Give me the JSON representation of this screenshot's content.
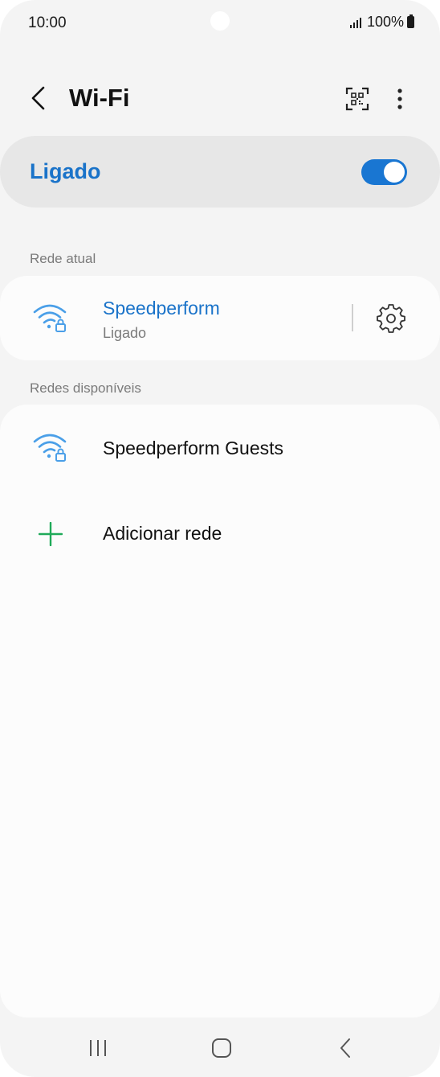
{
  "status_bar": {
    "time": "10:00",
    "battery_text": "100%",
    "signal_icon": "signal-bars-icon",
    "battery_icon": "battery-icon"
  },
  "app_bar": {
    "title": "Wi-Fi",
    "back_icon": "back-chevron-icon",
    "qr_icon": "qr-code-scanner-icon",
    "more_icon": "more-vertical-icon"
  },
  "master_switch": {
    "label": "Ligado",
    "on": true
  },
  "current_section": {
    "label": "Rede atual",
    "network": {
      "name": "Speedperform",
      "status": "Ligado",
      "icon": "wifi-secured-icon",
      "settings_icon": "gear-icon"
    }
  },
  "available_section": {
    "label": "Redes disponíveis",
    "networks": [
      {
        "name": "Speedperform Guests",
        "icon": "wifi-secured-icon"
      }
    ],
    "add_network": {
      "label": "Adicionar rede",
      "icon": "plus-icon"
    }
  },
  "nav_bar": {
    "recents_icon": "recents-icon",
    "home_icon": "home-icon",
    "back_icon": "nav-back-icon"
  },
  "colors": {
    "accent": "#1a73c9",
    "toggle_on": "#1976d2",
    "wifi_icon": "#4a9fe8",
    "add_icon": "#1faa59",
    "background": "#f4f4f4",
    "card": "#fcfcfc"
  }
}
